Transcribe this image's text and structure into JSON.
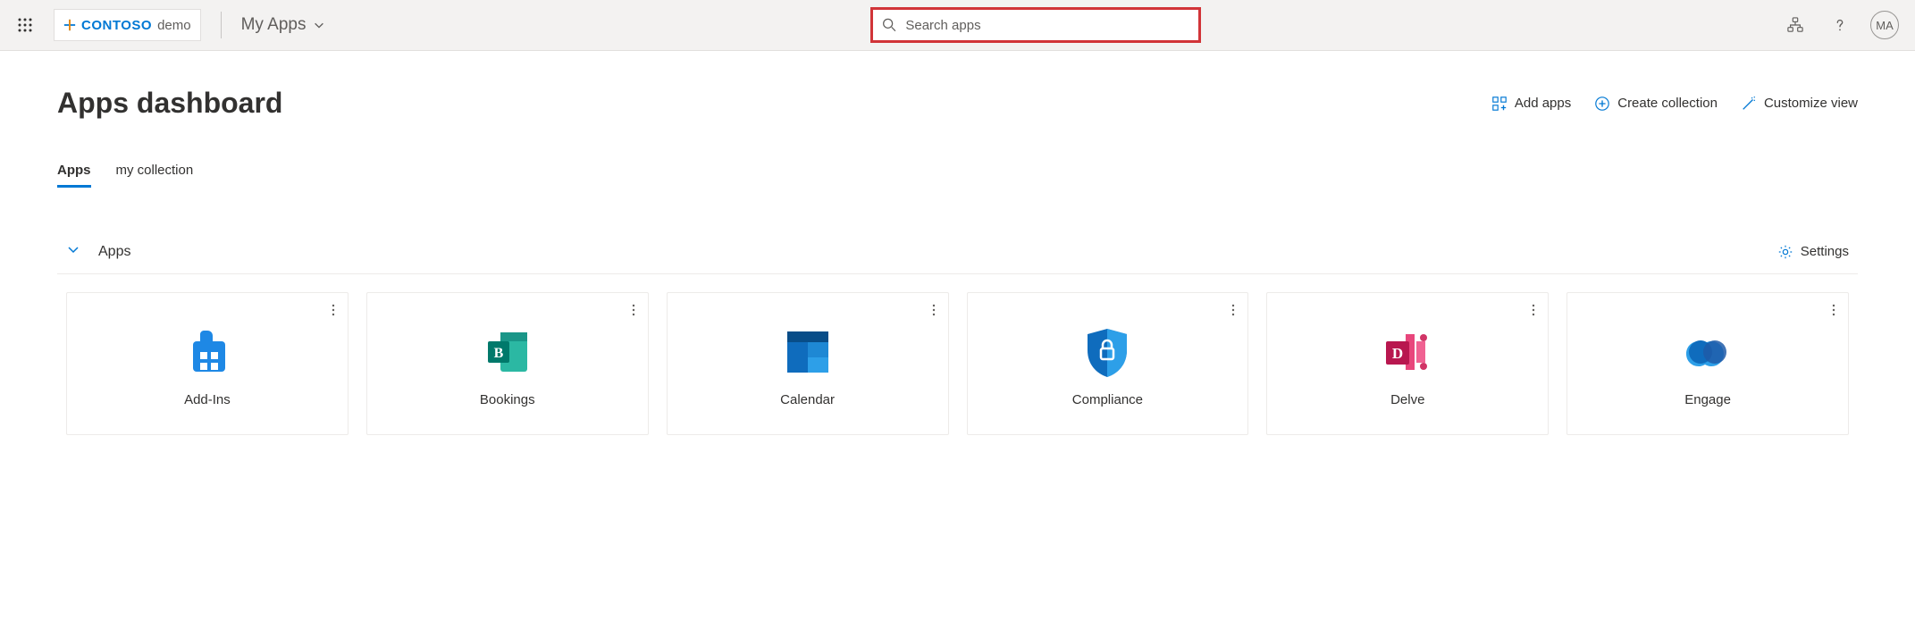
{
  "header": {
    "brand": "CONTOSO",
    "brand_suffix": "demo",
    "dropdown_label": "My Apps",
    "search_placeholder": "Search apps",
    "avatar_initials": "MA"
  },
  "page": {
    "title": "Apps dashboard",
    "actions": {
      "add_apps": "Add apps",
      "create_collection": "Create collection",
      "customize_view": "Customize view"
    }
  },
  "tabs": [
    {
      "label": "Apps",
      "active": true
    },
    {
      "label": "my collection",
      "active": false
    }
  ],
  "section": {
    "title": "Apps",
    "settings_label": "Settings"
  },
  "apps": [
    {
      "name": "Add-Ins",
      "icon": "addins"
    },
    {
      "name": "Bookings",
      "icon": "bookings"
    },
    {
      "name": "Calendar",
      "icon": "calendar"
    },
    {
      "name": "Compliance",
      "icon": "compliance"
    },
    {
      "name": "Delve",
      "icon": "delve"
    },
    {
      "name": "Engage",
      "icon": "engage"
    }
  ]
}
